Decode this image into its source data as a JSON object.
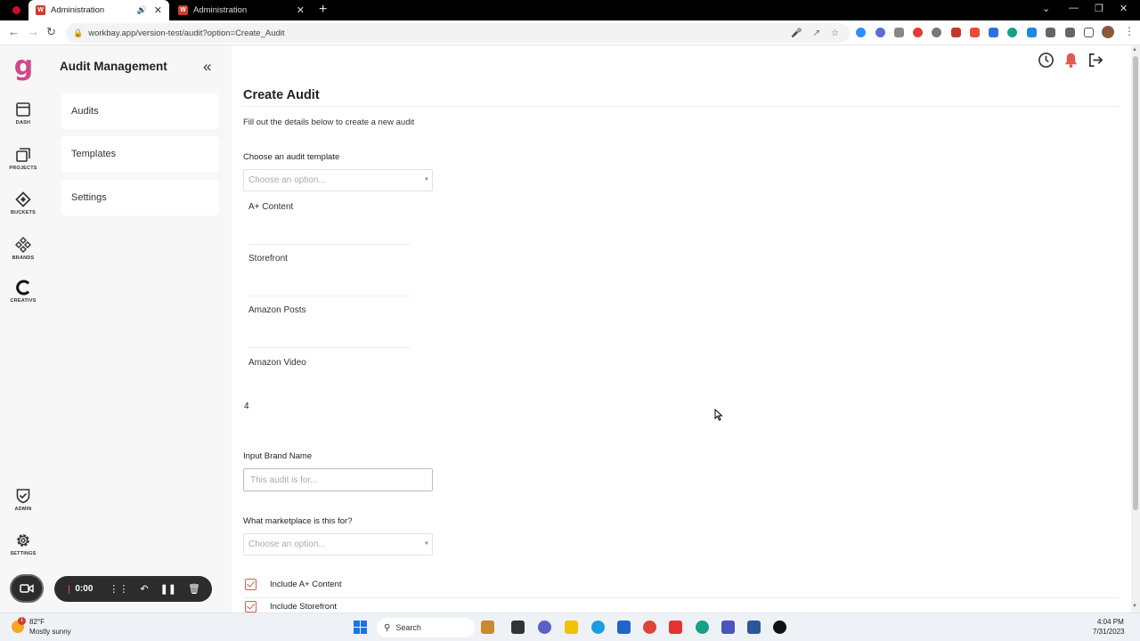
{
  "browser": {
    "tabs": [
      {
        "title": "Administration",
        "active": true
      },
      {
        "title": "Administration",
        "active": false
      }
    ],
    "url": "workbay.app/version-test/audit?option=Create_Audit",
    "extension_icons": [
      "zoom-icon",
      "settings-icon",
      "shirt-icon",
      "opera-icon",
      "location-icon",
      "mail-icon",
      "pdf-icon",
      "grid-icon",
      "analytics-icon",
      "calendar-icon",
      "puzzle-icon",
      "playlist-icon",
      "sidebar-icon"
    ]
  },
  "app": {
    "brand_color": "#d04a8b",
    "accent_color": "#e05a4f",
    "rail": [
      {
        "id": "dash",
        "label": "DASH",
        "icon": "dashboard-icon"
      },
      {
        "id": "projects",
        "label": "PROJECTS",
        "icon": "projects-icon"
      },
      {
        "id": "buckets",
        "label": "BUCKETS",
        "icon": "buckets-icon"
      },
      {
        "id": "brands",
        "label": "BRANDS",
        "icon": "brands-icon"
      },
      {
        "id": "creativs",
        "label": "CREATIVS",
        "icon": "creatives-icon"
      },
      {
        "id": "admin",
        "label": "ADMIN",
        "icon": "admin-shield-icon"
      },
      {
        "id": "settings",
        "label": "SETTINGS",
        "icon": "gear-icon"
      }
    ],
    "side_panel": {
      "title": "Audit Management",
      "items": [
        {
          "label": "Audits"
        },
        {
          "label": "Templates"
        },
        {
          "label": "Settings"
        }
      ]
    },
    "header_icons": [
      "history-icon",
      "notification-bell-icon",
      "logout-icon"
    ]
  },
  "form": {
    "title": "Create Audit",
    "subtitle": "Fill out the details below to create a new audit",
    "template": {
      "label": "Choose an audit template",
      "placeholder": "Choose an option...",
      "options": [
        "A+ Content",
        "Storefront",
        "Amazon Posts",
        "Amazon Video"
      ],
      "count": "4"
    },
    "brand": {
      "label": "Input Brand Name",
      "placeholder": "This audit is for..."
    },
    "marketplace": {
      "label": "What marketplace is this for?",
      "placeholder": "Choose an option..."
    },
    "checkboxes": [
      {
        "label": "Include A+ Content",
        "checked": true
      },
      {
        "label": "Include Storefront",
        "checked": true
      }
    ]
  },
  "recorder": {
    "time": "0:00"
  },
  "taskbar": {
    "temperature": "82°F",
    "weather": "Mostly sunny",
    "weather_badge": "1",
    "search_label": "Search",
    "time": "4:04 PM",
    "date": "7/31/2023"
  }
}
